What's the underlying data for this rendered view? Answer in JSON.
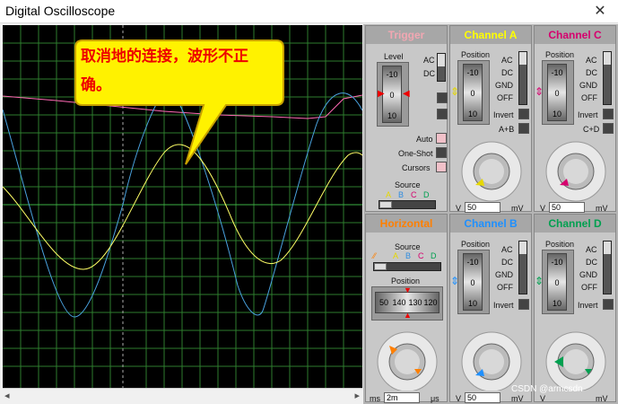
{
  "window": {
    "title": "Digital Oscilloscope",
    "close_label": "✕"
  },
  "callout": {
    "text": "取消地的连接，波形不正确。"
  },
  "trigger": {
    "header": "Trigger",
    "level_label": "Level",
    "drum": [
      "-10",
      "0",
      "10"
    ],
    "ac": "AC",
    "dc": "DC",
    "auto": "Auto",
    "one_shot": "One-Shot",
    "cursors": "Cursors",
    "source_label": "Source",
    "sources": [
      "A",
      "B",
      "C",
      "D"
    ]
  },
  "channel_a": {
    "header": "Channel A",
    "color": "#ffff00",
    "position_label": "Position",
    "drum": [
      "-10",
      "0",
      "10"
    ],
    "ac": "AC",
    "dc": "DC",
    "gnd": "GND",
    "off": "OFF",
    "invert": "Invert",
    "combine": "A+B",
    "scale": [
      "0.5",
      "0.2",
      "0.1",
      "50",
      "20",
      "10",
      "5",
      "2",
      "1",
      "0.5",
      "0.2",
      "0.1",
      "50",
      "20"
    ],
    "unit_left": "V",
    "unit_right": "mV",
    "value": "50"
  },
  "channel_c": {
    "header": "Channel C",
    "color": "#e0007a",
    "position_label": "Position",
    "drum": [
      "-10",
      "0",
      "10"
    ],
    "ac": "AC",
    "dc": "DC",
    "gnd": "GND",
    "off": "OFF",
    "invert": "Invert",
    "combine": "C+D",
    "unit_left": "V",
    "unit_right": "mV",
    "value": "50"
  },
  "horizontal": {
    "header": "Horizontal",
    "color": "#ff7f00",
    "source_label": "Source",
    "sources": [
      "A",
      "B",
      "C",
      "D"
    ],
    "position_label": "Position",
    "drum": [
      "50",
      "140",
      "130",
      "120"
    ],
    "scale": [
      "0.5",
      "0.2",
      "0.1",
      "50",
      "20",
      "10",
      "5",
      "2",
      "1",
      "0.5",
      "0.2",
      "0.1",
      "50",
      "20",
      "10",
      "5",
      "2",
      "1",
      "500",
      "200"
    ],
    "unit_left": "ms",
    "unit_right": "μs",
    "value": "2m"
  },
  "channel_b": {
    "header": "Channel B",
    "color": "#1e90ff",
    "position_label": "Position",
    "drum": [
      "-10",
      "0",
      "10"
    ],
    "ac": "AC",
    "dc": "DC",
    "gnd": "GND",
    "off": "OFF",
    "invert": "Invert",
    "unit_left": "V",
    "unit_right": "mV",
    "value": "50"
  },
  "channel_d": {
    "header": "Channel D",
    "color": "#00a050",
    "position_label": "Position",
    "drum": [
      "-10",
      "0",
      "10"
    ],
    "ac": "AC",
    "dc": "DC",
    "gnd": "GND",
    "off": "OFF",
    "invert": "Invert",
    "unit_left": "V",
    "unit_right": "mV"
  },
  "watermark": "CSDN @armcsdn"
}
